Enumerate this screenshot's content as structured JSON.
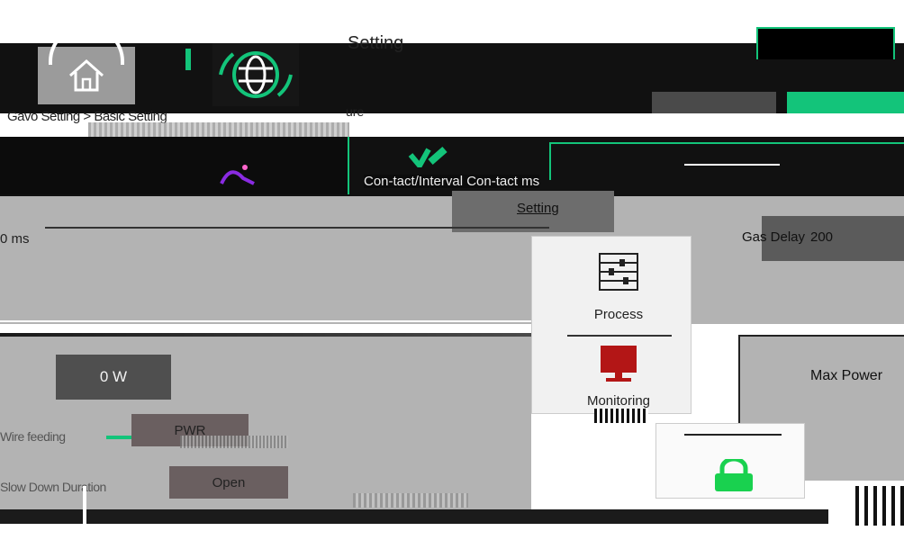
{
  "header": {
    "title": "Setting",
    "breadcrumb": "Gavo Setting > Basic Setting",
    "subtitle_fragment": "ure"
  },
  "nav": {
    "home_icon": "home-icon",
    "language_icon": "globe-refresh-icon"
  },
  "top_buttons": {
    "left_label": "",
    "right_label": ""
  },
  "middle": {
    "feed_label": "Con-tact/Interval Con-tact ms",
    "setting_label": "Setting",
    "gas_delay_label": "Gas Delay",
    "gas_delay_value": "200",
    "left_ms": "0 ms"
  },
  "popup_menu": {
    "items": [
      {
        "label": "Process",
        "icon": "sliders-icon"
      },
      {
        "label": "Monitoring",
        "icon": "monitor-icon"
      }
    ],
    "lock_icon": "lock-icon"
  },
  "power": {
    "value": "0 W",
    "max_label": "Max Power"
  },
  "lower": {
    "row1_label": "Wire feeding",
    "row1_button": "PWR",
    "row2_label": "Slow Down Duration",
    "row2_button": "Open"
  },
  "colors": {
    "accent": "#13c47a",
    "monitor_red": "#b31616",
    "lock_green": "#19d14f",
    "purple_icon": "#8a2be2"
  }
}
